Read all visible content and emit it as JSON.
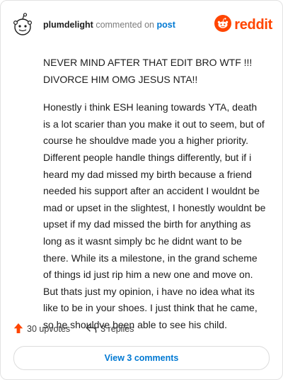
{
  "header": {
    "username": "plumdelight",
    "action_text": "commented on",
    "target_text": "post",
    "brand": "reddit",
    "brand_color": "#ff4500",
    "avatar_icon": "snoo-avatar-icon",
    "brand_icon": "reddit-logo-icon"
  },
  "comment": {
    "paragraphs": [
      "NEVER MIND AFTER THAT EDIT BRO WTF !!! DIVORCE HIM OMG JESUS NTA!!",
      "Honestly i think ESH leaning towards YTA, death is a lot scarier than you make it out to seem, but of course he shouldve made you a higher priority. Different people handle things differently, but if i heard my dad missed my birth because a friend needed his support after an accident I wouldnt be mad or upset in the slightest, I honestly wouldnt be upset if my dad missed the birth for anything as long as it wasnt simply bc he didnt want to be there. While its a milestone, in the grand scheme of things id just rip him a new one and move on. But thats just my opinion, i have no idea what its like to be in your shoes. I just think that he came, so he shouldve been able to see his child."
    ]
  },
  "actions": {
    "upvotes_label": "30 upvotes",
    "upvote_icon": "upvote-arrow-icon",
    "upvote_color": "#ff4500",
    "replies_label": "3 replies",
    "reply_icon": "reply-icon"
  },
  "footer": {
    "view_comments_label": "View 3 comments",
    "link_color": "#0079d3"
  }
}
